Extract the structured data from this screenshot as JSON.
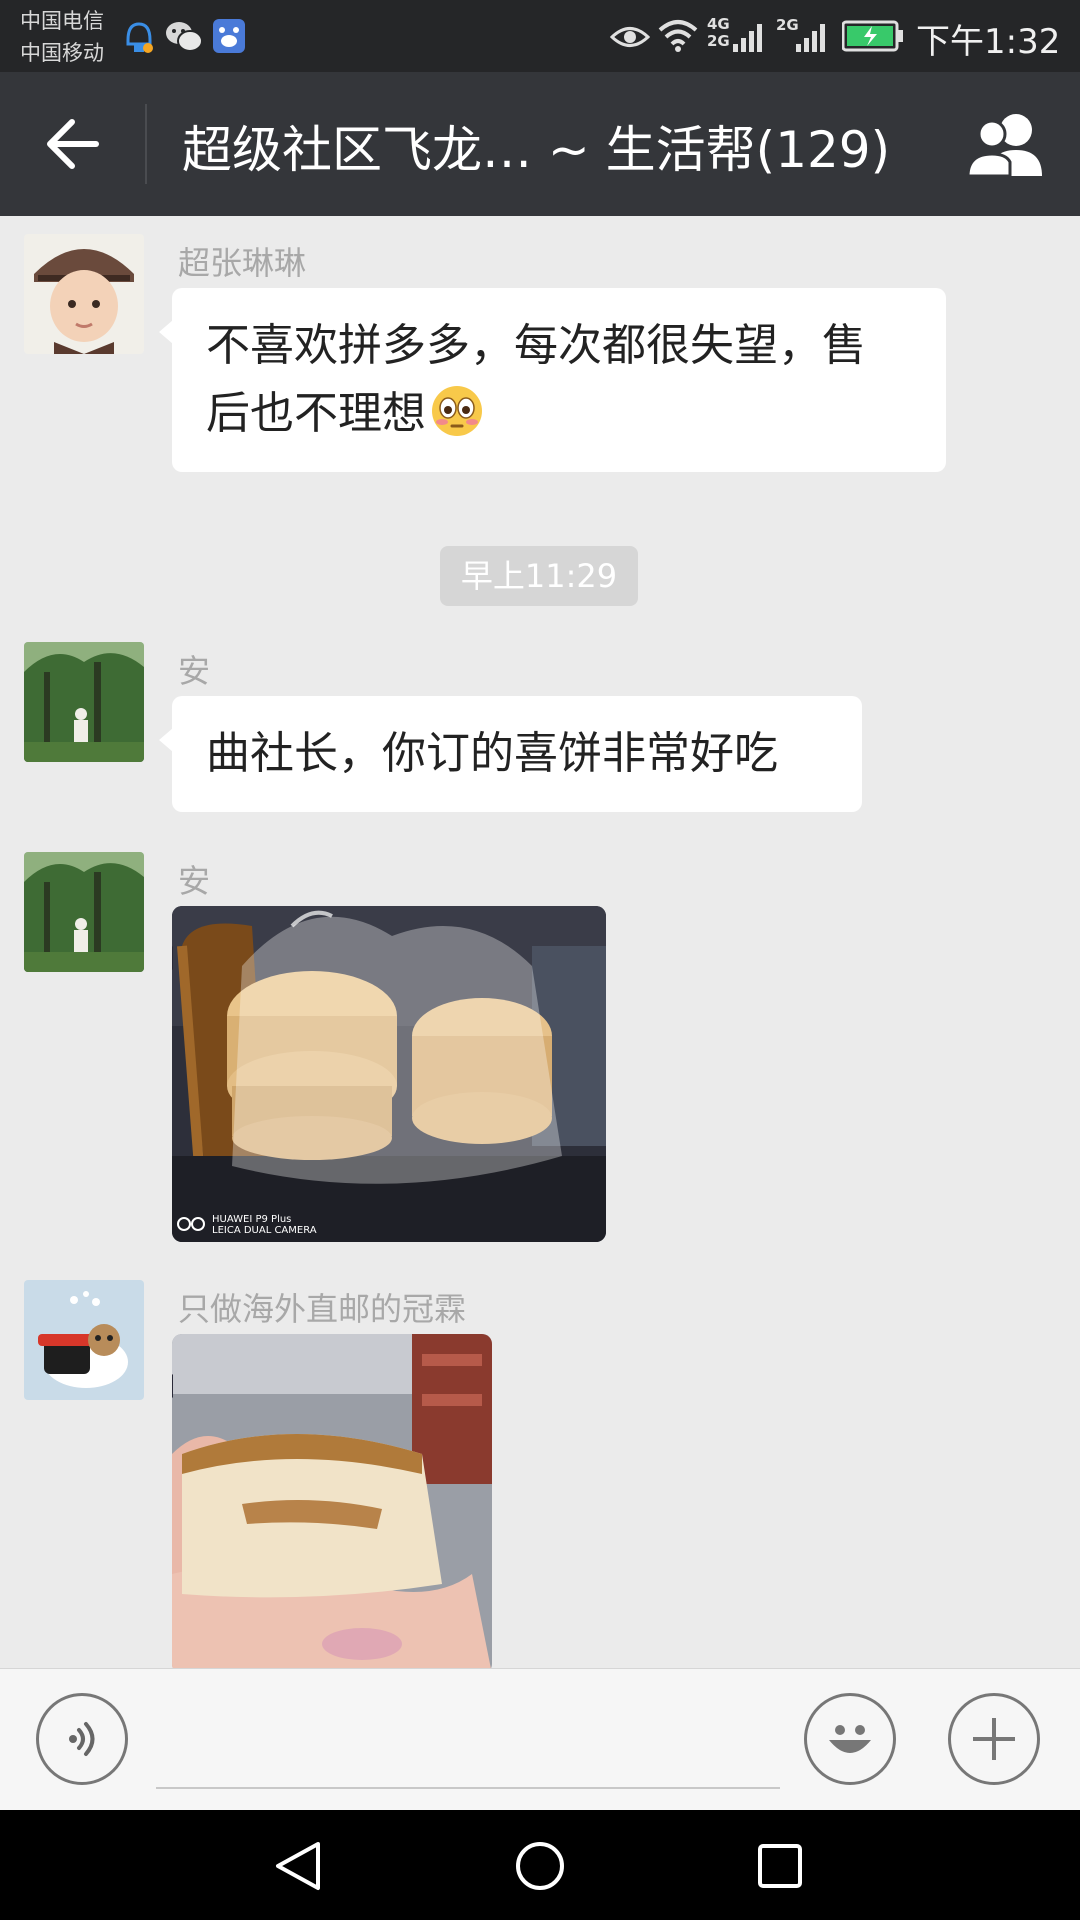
{
  "status_bar": {
    "carrier_1": "中国电信",
    "carrier_2": "中国移动",
    "network_1": "4G",
    "network_2": "2G",
    "network_3": "2G",
    "time": "下午1:32",
    "icons": [
      "notification-bell-icon",
      "wechat-icon",
      "baidu-icon",
      "eye-icon",
      "wifi-icon",
      "signal-icon",
      "battery-charging-icon"
    ]
  },
  "header": {
    "title": "超级社区飞龙… ~ 生活帮(129)",
    "back_icon": "back-arrow-icon",
    "members_icon": "group-members-icon"
  },
  "messages": [
    {
      "type": "text",
      "sender": "超张琳琳",
      "line1": "不喜欢拼多多，每次都很失望，售",
      "line2": "后也不理想",
      "emoji": "😳"
    },
    {
      "type": "timestamp",
      "text": "早上11:29"
    },
    {
      "type": "text",
      "sender": "安",
      "text": "曲社长，你订的喜饼非常好吃"
    },
    {
      "type": "image",
      "sender": "安",
      "watermark_brand": "HUAWEI P9 Plus",
      "watermark_camera": "LEICA DUAL CAMERA"
    },
    {
      "type": "image",
      "sender": "只做海外直邮的冠霖"
    }
  ],
  "input_bar": {
    "voice_icon": "voice-input-icon",
    "emoji_icon": "emoji-icon",
    "plus_icon": "plus-icon"
  },
  "system_nav": {
    "back_icon": "nav-back-icon",
    "home_icon": "nav-home-icon",
    "recents_icon": "nav-recents-icon"
  },
  "colors": {
    "status_bar_bg": "#252628",
    "header_bg": "#34363a",
    "chat_bg": "#ebebeb",
    "bubble_bg": "#ffffff",
    "timestamp_bg": "#d6d6d6",
    "input_bar_bg": "#f6f6f6",
    "nav_bg": "#000000"
  }
}
